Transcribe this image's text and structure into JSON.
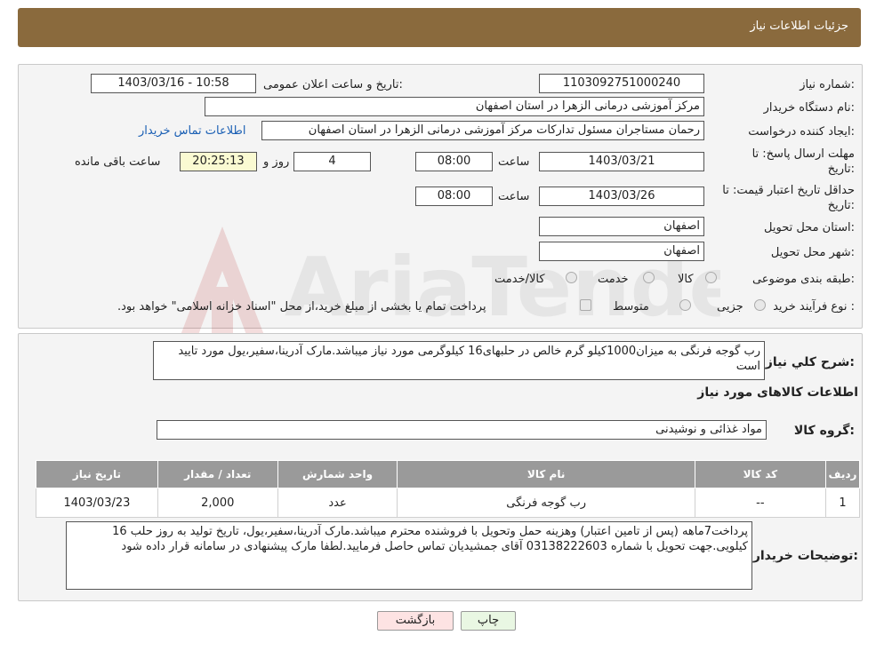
{
  "header": {
    "title": "جزئیات اطلاعات نیاز"
  },
  "form": {
    "need_number_label": "شماره نیاز:",
    "need_number": "1103092751000240",
    "announce_label": "تاریخ و ساعت اعلان عمومی:",
    "announce_value": "1403/03/16 - 10:58",
    "buyer_org_label": "نام دستگاه خریدار:",
    "buyer_org": "مرکز آموزشی درمانی الزهرا در استان اصفهان",
    "creator_label": "ایجاد کننده درخواست:",
    "creator": "رحمان مستاجران مسئول تدارکات مرکز آموزشی درمانی الزهرا در استان اصفهان",
    "contact_link": "اطلاعات تماس خریدار",
    "reply_deadline_label1": "مهلت ارسال پاسخ: تا",
    "reply_deadline_label2": "تاریخ:",
    "reply_date": "1403/03/21",
    "time_label": "ساعت",
    "reply_time": "08:00",
    "days_value": "4",
    "days_label": "روز و",
    "remaining_time": "20:25:13",
    "remaining_label": "ساعت باقی مانده",
    "min_validity_label1": "حداقل تاریخ اعتبار قیمت: تا",
    "min_validity_label2": "تاریخ:",
    "validity_date": "1403/03/26",
    "validity_time": "08:00",
    "province_label": "استان محل تحویل:",
    "province": "اصفهان",
    "city_label": "شهر محل تحویل:",
    "city": "اصفهان",
    "category_label": "طبقه بندی موضوعی:",
    "category_options": [
      "کالا",
      "خدمت",
      "کالا/خدمت"
    ],
    "purchase_type_label": "نوع فرآیند خرید :",
    "purchase_options": [
      "جزیی",
      "متوسط"
    ],
    "purchase_note": "پرداخت تمام یا بخشی از مبلغ خرید،از محل \"اسناد خزانه اسلامی\" خواهد بود."
  },
  "details": {
    "summary_label": "شرح کلي نياز:",
    "summary_text": "رب گوجه فرنگی به میزان1000کیلو گرم خالص در حلبهای16 کیلوگرمی مورد نیاز میباشد.مارک آدرینا،سفیر،یول مورد تایید است",
    "items_heading": "اطلاعات کالاهای مورد نیاز",
    "group_label": "گروه کالا:",
    "group_value": "مواد غذائی و نوشیدنی",
    "table": {
      "headers": [
        "ردیف",
        "کد کالا",
        "نام کالا",
        "واحد شمارش",
        "تعداد / مقدار",
        "تاریخ نیاز"
      ],
      "rows": [
        [
          "1",
          "--",
          "رب گوجه فرنگی",
          "عدد",
          "2,000",
          "1403/03/23"
        ]
      ]
    },
    "buyer_notes_label": "توضیحات خریدار:",
    "buyer_notes": "پرداخت7ماهه (پس از تامین اعتبار) وهزینه حمل وتحویل با فروشنده محترم میباشد.مارک آدرینا،سفیر،یول، تاریخ تولید به روز حلب 16 کیلویی.جهت تحویل با شماره 03138222603 آقای جمشیدیان  تماس حاصل فرمایید.لطفا مارک پیشنهادی در سامانه قرار داده شود"
  },
  "buttons": {
    "print": "چاپ",
    "back": "بازگشت"
  },
  "watermark": {
    "text": "AriaTender.neT"
  },
  "colors": {
    "header_bg": "#8a6a3d",
    "link": "#1a5fb4",
    "back_button_bg": "#fde3e3",
    "print_button_bg": "#e9f7e3"
  }
}
